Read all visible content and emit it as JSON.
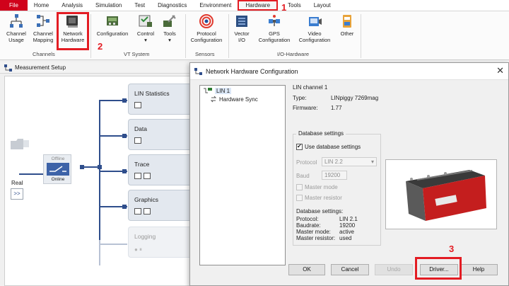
{
  "ribbon_tabs": [
    "File",
    "Home",
    "Analysis",
    "Simulation",
    "Test",
    "Diagnostics",
    "Environment",
    "Hardware",
    "Tools",
    "Layout"
  ],
  "ribbon": {
    "buttons": {
      "channel_usage": "Channel\nUsage",
      "channel_mapping": "Channel\nMapping",
      "network_hardware": "Network\nHardware",
      "configuration": "Configuration",
      "control": "Control",
      "tools": "Tools",
      "protocol_configuration": "Protocol\nConfiguration",
      "vector_io": "Vector\nI/O",
      "gps_configuration": "GPS\nConfiguration",
      "video_configuration": "Video\nConfiguration",
      "other": "Other"
    },
    "dropdown_marker": "▾",
    "groups": {
      "channels": "Channels",
      "vt_system": "VT System",
      "sensors": "Sensors",
      "io_hardware": "I/O-Hardware"
    }
  },
  "annotations": {
    "step1": "1",
    "step2": "2",
    "step3": "3",
    "accent_color": "#e31c23"
  },
  "measurement_setup": {
    "title": "Measurement Setup",
    "blocks": [
      "LIN Statistics",
      "Data",
      "Trace",
      "Graphics",
      "Logging"
    ],
    "switch_top": "Offline",
    "switch_bottom": "Online",
    "real_label": "Real",
    "real_button": ">>",
    "logging_controls": "● ⏸"
  },
  "dialog": {
    "title": "Network Hardware Configuration",
    "close": "✕",
    "tree": [
      "LIN 1",
      "Hardware Sync"
    ],
    "channel_heading": "LIN channel 1",
    "type_label": "Type:",
    "type_value": "LINpiggy 7269mag",
    "firmware_label": "Firmware:",
    "firmware_value": "1.77",
    "db_group": "Database settings",
    "use_db": "Use database settings",
    "protocol_label": "Protocol",
    "protocol_value": "LIN 2.2",
    "baud_label": "Baud",
    "baud_value": "19200",
    "master_mode": "Master mode",
    "master_resistor": "Master resistor",
    "db_summary_heading": "Database settings:",
    "db_summary": [
      {
        "k": "Protocol:",
        "v": "LIN 2.1"
      },
      {
        "k": "Baudrate:",
        "v": "19200"
      },
      {
        "k": "Master mode:",
        "v": "active"
      },
      {
        "k": "Master resistor:",
        "v": "used"
      }
    ],
    "buttons": {
      "ok": "OK",
      "cancel": "Cancel",
      "undo": "Undo",
      "driver": "Driver...",
      "help": "Help"
    }
  }
}
